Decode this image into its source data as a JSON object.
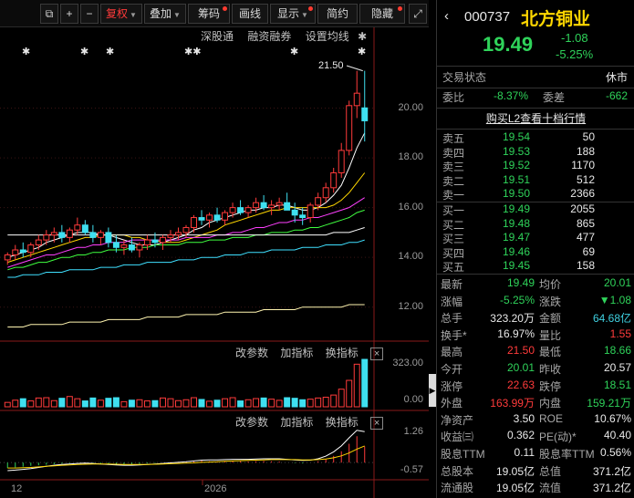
{
  "toolbar": {
    "buttons": [
      {
        "label": "复权",
        "active": true,
        "caret": true
      },
      {
        "label": "叠加",
        "caret": true
      },
      {
        "label": "筹码",
        "dot": true
      },
      {
        "label": "画线"
      },
      {
        "label": "显示",
        "dot": true
      },
      {
        "label": "简约"
      },
      {
        "label": "隐藏",
        "dot": true
      }
    ]
  },
  "chart_header": {
    "links": [
      "深股通",
      "融资融券",
      "设置均线"
    ],
    "high_marker": "21.50"
  },
  "price_axis": [
    "20.00",
    "18.00",
    "16.00",
    "14.00",
    "12.00"
  ],
  "volume_panel": {
    "title_items": [
      "改参数",
      "加指标",
      "换指标"
    ],
    "axis_top": "323.00",
    "axis_bottom": "0.00"
  },
  "macd_panel": {
    "title_items": [
      "改参数",
      "加指标",
      "换指标"
    ],
    "axis_top": "1.26",
    "axis_bottom": "-0.57"
  },
  "time_axis": [
    "12",
    "2026"
  ],
  "stock": {
    "code": "000737",
    "name": "北方铜业",
    "price": "19.49",
    "change": "-1.08",
    "change_pct": "-5.25%"
  },
  "status": {
    "label": "交易状态",
    "value": "休市"
  },
  "ratio": {
    "wb_label": "委比",
    "wb_value": "-8.37%",
    "wc_label": "委差",
    "wc_value": "-662"
  },
  "level2": "购买L2查看十档行情",
  "sell": [
    {
      "label": "卖五",
      "price": "19.54",
      "vol": "50"
    },
    {
      "label": "卖四",
      "price": "19.53",
      "vol": "188"
    },
    {
      "label": "卖三",
      "price": "19.52",
      "vol": "1170"
    },
    {
      "label": "卖二",
      "price": "19.51",
      "vol": "512"
    },
    {
      "label": "卖一",
      "price": "19.50",
      "vol": "2366"
    }
  ],
  "buy": [
    {
      "label": "买一",
      "price": "19.49",
      "vol": "2055"
    },
    {
      "label": "买二",
      "price": "19.48",
      "vol": "865"
    },
    {
      "label": "买三",
      "price": "19.47",
      "vol": "477"
    },
    {
      "label": "买四",
      "price": "19.46",
      "vol": "69"
    },
    {
      "label": "买五",
      "price": "19.45",
      "vol": "158"
    }
  ],
  "stats": [
    {
      "l1": "最新",
      "v1": "19.49",
      "c1": "green",
      "l2": "均价",
      "v2": "20.01",
      "c2": "green"
    },
    {
      "l1": "涨幅",
      "v1": "-5.25%",
      "c1": "green",
      "l2": "涨跌",
      "v2": "▼1.08",
      "c2": "green"
    },
    {
      "l1": "总手",
      "v1": "323.20万",
      "c1": "white",
      "l2": "金额",
      "v2": "64.68亿",
      "c2": "cyan"
    },
    {
      "l1": "换手*",
      "v1": "16.97%",
      "c1": "white",
      "l2": "量比",
      "v2": "1.55",
      "c2": "red"
    },
    {
      "l1": "最高",
      "v1": "21.50",
      "c1": "red",
      "l2": "最低",
      "v2": "18.66",
      "c2": "green"
    },
    {
      "l1": "今开",
      "v1": "20.01",
      "c1": "green",
      "l2": "昨收",
      "v2": "20.57",
      "c2": "white"
    },
    {
      "l1": "涨停",
      "v1": "22.63",
      "c1": "red",
      "l2": "跌停",
      "v2": "18.51",
      "c2": "green"
    },
    {
      "l1": "外盘",
      "v1": "163.99万",
      "c1": "red",
      "l2": "内盘",
      "v2": "159.21万",
      "c2": "green"
    },
    {
      "l1": "净资产",
      "v1": "3.50",
      "c1": "white",
      "l2": "ROE",
      "v2": "10.67%",
      "c2": "white"
    },
    {
      "l1": "收益㈢",
      "v1": "0.362",
      "c1": "white",
      "l2": "PE(动)*",
      "v2": "40.40",
      "c2": "white"
    },
    {
      "l1": "股息TTM",
      "v1": "0.11",
      "c1": "white",
      "l2": "股息率TTM",
      "v2": "0.56%",
      "c2": "white"
    },
    {
      "l1": "总股本",
      "v1": "19.05亿",
      "c1": "white",
      "l2": "总值",
      "v2": "371.2亿",
      "c2": "white"
    },
    {
      "l1": "流通股",
      "v1": "19.05亿",
      "c1": "white",
      "l2": "流值",
      "v2": "371.2亿",
      "c2": "white"
    }
  ],
  "chart_data": {
    "type": "candlestick",
    "yrange": [
      11.0,
      22.0
    ],
    "candles": [
      [
        13.9,
        14.2,
        13.7,
        14.1
      ],
      [
        14.1,
        14.5,
        13.9,
        14.3
      ],
      [
        14.3,
        14.6,
        14.0,
        14.2
      ],
      [
        14.2,
        14.6,
        14.0,
        14.5
      ],
      [
        14.5,
        14.9,
        14.3,
        14.7
      ],
      [
        14.7,
        15.1,
        14.5,
        14.9
      ],
      [
        14.9,
        15.2,
        14.6,
        15.0
      ],
      [
        15.0,
        15.3,
        14.6,
        14.8
      ],
      [
        14.8,
        15.2,
        14.6,
        15.1
      ],
      [
        15.1,
        15.6,
        14.9,
        15.3
      ],
      [
        15.3,
        15.5,
        14.9,
        15.0
      ],
      [
        15.0,
        15.3,
        14.6,
        14.8
      ],
      [
        14.8,
        15.1,
        14.5,
        15.0
      ],
      [
        15.0,
        15.2,
        14.4,
        14.6
      ],
      [
        14.6,
        14.9,
        14.2,
        14.4
      ],
      [
        14.4,
        14.7,
        14.1,
        14.5
      ],
      [
        14.5,
        14.8,
        14.2,
        14.3
      ],
      [
        14.3,
        14.6,
        14.0,
        14.5
      ],
      [
        14.5,
        14.9,
        14.3,
        14.7
      ],
      [
        14.7,
        15.0,
        14.4,
        14.6
      ],
      [
        14.6,
        14.9,
        14.3,
        14.8
      ],
      [
        14.8,
        15.1,
        14.6,
        14.9
      ],
      [
        14.9,
        15.2,
        14.7,
        15.0
      ],
      [
        15.0,
        15.3,
        14.8,
        15.2
      ],
      [
        15.2,
        15.7,
        15.0,
        15.6
      ],
      [
        15.6,
        15.9,
        15.3,
        15.5
      ],
      [
        15.5,
        15.8,
        15.2,
        15.7
      ],
      [
        15.7,
        16.0,
        15.4,
        15.5
      ],
      [
        15.5,
        15.9,
        15.3,
        15.8
      ],
      [
        15.8,
        16.2,
        15.6,
        16.0
      ],
      [
        16.0,
        16.3,
        15.7,
        15.8
      ],
      [
        15.8,
        16.1,
        15.6,
        16.0
      ],
      [
        16.0,
        16.4,
        15.8,
        16.2
      ],
      [
        16.2,
        16.5,
        15.9,
        16.0
      ],
      [
        16.0,
        16.3,
        15.7,
        16.1
      ],
      [
        16.1,
        16.4,
        15.9,
        16.2
      ],
      [
        16.2,
        16.6,
        15.9,
        15.9
      ],
      [
        15.9,
        16.2,
        15.4,
        15.7
      ],
      [
        15.7,
        16.0,
        15.3,
        15.6
      ],
      [
        15.6,
        16.2,
        15.4,
        16.1
      ],
      [
        16.1,
        16.6,
        15.9,
        16.4
      ],
      [
        16.4,
        17.0,
        16.2,
        16.8
      ],
      [
        16.8,
        17.6,
        16.6,
        17.4
      ],
      [
        17.4,
        18.6,
        17.2,
        18.3
      ],
      [
        18.3,
        20.3,
        18.1,
        20.1
      ],
      [
        20.1,
        21.5,
        19.6,
        20.6
      ],
      [
        20.01,
        21.5,
        18.66,
        19.49
      ]
    ],
    "ma": [
      {
        "name": "MA5",
        "color": "#ffffff",
        "values": [
          14.0,
          14.1,
          14.2,
          14.3,
          14.4,
          14.6,
          14.7,
          14.8,
          14.9,
          15.0,
          15.0,
          15.0,
          14.9,
          14.9,
          14.8,
          14.7,
          14.6,
          14.5,
          14.5,
          14.5,
          14.6,
          14.7,
          14.8,
          14.9,
          15.1,
          15.2,
          15.4,
          15.5,
          15.6,
          15.7,
          15.8,
          15.9,
          15.9,
          16.0,
          16.0,
          16.1,
          16.1,
          16.0,
          15.9,
          15.9,
          16.0,
          16.2,
          16.5,
          16.9,
          17.6,
          18.4,
          19.0
        ]
      },
      {
        "name": "MA10",
        "color": "#ffd700",
        "values": [
          13.8,
          13.9,
          14.0,
          14.1,
          14.2,
          14.3,
          14.4,
          14.5,
          14.6,
          14.7,
          14.8,
          14.8,
          14.9,
          14.9,
          14.9,
          14.9,
          14.8,
          14.8,
          14.7,
          14.7,
          14.6,
          14.6,
          14.6,
          14.7,
          14.8,
          14.9,
          15.0,
          15.1,
          15.3,
          15.4,
          15.5,
          15.6,
          15.7,
          15.8,
          15.9,
          15.9,
          16.0,
          16.0,
          16.0,
          16.0,
          16.0,
          16.0,
          16.1,
          16.3,
          16.6,
          17.0,
          17.4
        ]
      },
      {
        "name": "MA20",
        "color": "#ff3fff",
        "values": [
          13.6,
          13.7,
          13.8,
          13.9,
          14.0,
          14.1,
          14.1,
          14.2,
          14.3,
          14.4,
          14.4,
          14.5,
          14.5,
          14.6,
          14.6,
          14.6,
          14.7,
          14.7,
          14.7,
          14.7,
          14.7,
          14.7,
          14.7,
          14.8,
          14.8,
          14.8,
          14.8,
          14.9,
          14.9,
          15.0,
          15.0,
          15.1,
          15.2,
          15.2,
          15.3,
          15.4,
          15.4,
          15.5,
          15.5,
          15.6,
          15.6,
          15.7,
          15.8,
          15.9,
          16.0,
          16.2,
          16.4
        ]
      },
      {
        "name": "MA30",
        "color": "#3fff3f",
        "values": [
          13.5,
          13.6,
          13.6,
          13.7,
          13.8,
          13.8,
          13.9,
          14.0,
          14.0,
          14.1,
          14.1,
          14.2,
          14.2,
          14.3,
          14.3,
          14.3,
          14.4,
          14.4,
          14.4,
          14.5,
          14.5,
          14.5,
          14.5,
          14.6,
          14.6,
          14.6,
          14.7,
          14.7,
          14.7,
          14.8,
          14.8,
          14.8,
          14.9,
          14.9,
          15.0,
          15.0,
          15.0,
          15.1,
          15.1,
          15.2,
          15.2,
          15.3,
          15.4,
          15.5,
          15.6,
          15.8,
          15.9
        ]
      },
      {
        "name": "MA60",
        "color": "#ffffff",
        "values": [
          14.9,
          14.9,
          14.9,
          14.9,
          14.9,
          14.9,
          14.9,
          14.9,
          14.9,
          14.9,
          14.9,
          14.9,
          14.9,
          14.9,
          14.9,
          14.9,
          14.9,
          14.9,
          14.9,
          14.9,
          14.9,
          14.9,
          14.9,
          14.9,
          14.9,
          14.9,
          14.9,
          14.9,
          14.9,
          14.9,
          14.9,
          14.9,
          14.9,
          14.9,
          14.9,
          14.9,
          14.9,
          14.9,
          14.9,
          14.9,
          14.9,
          14.9,
          15.0,
          15.0,
          15.0,
          15.1,
          15.2
        ]
      },
      {
        "name": "MA120",
        "color": "#3fe0ff",
        "values": [
          13.2,
          13.2,
          13.3,
          13.3,
          13.3,
          13.4,
          13.4,
          13.4,
          13.5,
          13.5,
          13.5,
          13.5,
          13.6,
          13.6,
          13.6,
          13.7,
          13.7,
          13.7,
          13.8,
          13.8,
          13.8,
          13.8,
          13.9,
          13.9,
          13.9,
          14.0,
          14.0,
          14.0,
          14.1,
          14.1,
          14.1,
          14.2,
          14.2,
          14.2,
          14.3,
          14.3,
          14.3,
          14.3,
          14.4,
          14.4,
          14.4,
          14.5,
          14.5,
          14.5,
          14.6,
          14.6,
          14.7
        ]
      },
      {
        "name": "MA250",
        "color": "#fff5b0",
        "values": [
          11.2,
          11.2,
          11.2,
          11.3,
          11.3,
          11.3,
          11.3,
          11.3,
          11.4,
          11.4,
          11.4,
          11.4,
          11.4,
          11.5,
          11.5,
          11.5,
          11.5,
          11.5,
          11.6,
          11.6,
          11.6,
          11.6,
          11.6,
          11.7,
          11.7,
          11.7,
          11.7,
          11.7,
          11.8,
          11.8,
          11.8,
          11.8,
          11.8,
          11.9,
          11.9,
          11.9,
          11.9,
          11.9,
          12.0,
          12.0,
          12.0,
          12.0,
          12.0,
          12.0,
          12.1,
          12.1,
          12.1
        ]
      }
    ],
    "volume": [
      30,
      45,
      55,
      40,
      60,
      62,
      42,
      58,
      70,
      55,
      40,
      60,
      45,
      58,
      62,
      35,
      45,
      48,
      40,
      42,
      60,
      55,
      42,
      48,
      62,
      50,
      38,
      45,
      55,
      62,
      40,
      48,
      56,
      60,
      52,
      44,
      62,
      58,
      48,
      52,
      60,
      65,
      80,
      120,
      180,
      290,
      323
    ],
    "volume_max": 323,
    "macd_hist": [
      -0.2,
      -0.18,
      -0.15,
      -0.12,
      -0.1,
      -0.08,
      -0.06,
      -0.04,
      -0.02,
      0.0,
      0.01,
      -0.02,
      -0.04,
      -0.05,
      -0.06,
      -0.07,
      -0.06,
      -0.05,
      -0.03,
      -0.02,
      0.0,
      0.02,
      0.03,
      0.04,
      0.06,
      0.07,
      0.05,
      0.04,
      0.05,
      0.06,
      0.05,
      0.04,
      0.05,
      0.06,
      0.05,
      0.04,
      0.0,
      -0.02,
      -0.03,
      0.0,
      0.05,
      0.12,
      0.25,
      0.42,
      0.7,
      0.98,
      0.6
    ],
    "macd_dif": [
      -0.3,
      -0.28,
      -0.25,
      -0.22,
      -0.18,
      -0.14,
      -0.1,
      -0.07,
      -0.05,
      -0.03,
      -0.02,
      -0.03,
      -0.05,
      -0.07,
      -0.09,
      -0.1,
      -0.1,
      -0.09,
      -0.07,
      -0.05,
      -0.03,
      -0.01,
      0.01,
      0.03,
      0.06,
      0.09,
      0.1,
      0.1,
      0.11,
      0.12,
      0.12,
      0.12,
      0.13,
      0.14,
      0.14,
      0.14,
      0.12,
      0.1,
      0.08,
      0.09,
      0.14,
      0.24,
      0.4,
      0.62,
      0.92,
      1.2,
      1.15
    ],
    "macd_dea": [
      -0.2,
      -0.2,
      -0.19,
      -0.18,
      -0.16,
      -0.14,
      -0.12,
      -0.1,
      -0.09,
      -0.07,
      -0.06,
      -0.05,
      -0.05,
      -0.05,
      -0.06,
      -0.07,
      -0.07,
      -0.07,
      -0.07,
      -0.06,
      -0.05,
      -0.04,
      -0.03,
      -0.02,
      -0.01,
      0.01,
      0.02,
      0.03,
      0.05,
      0.06,
      0.07,
      0.08,
      0.09,
      0.1,
      0.11,
      0.11,
      0.11,
      0.11,
      0.1,
      0.1,
      0.11,
      0.13,
      0.18,
      0.25,
      0.36,
      0.5,
      0.62
    ],
    "macd_range": [
      -0.57,
      1.26
    ]
  }
}
